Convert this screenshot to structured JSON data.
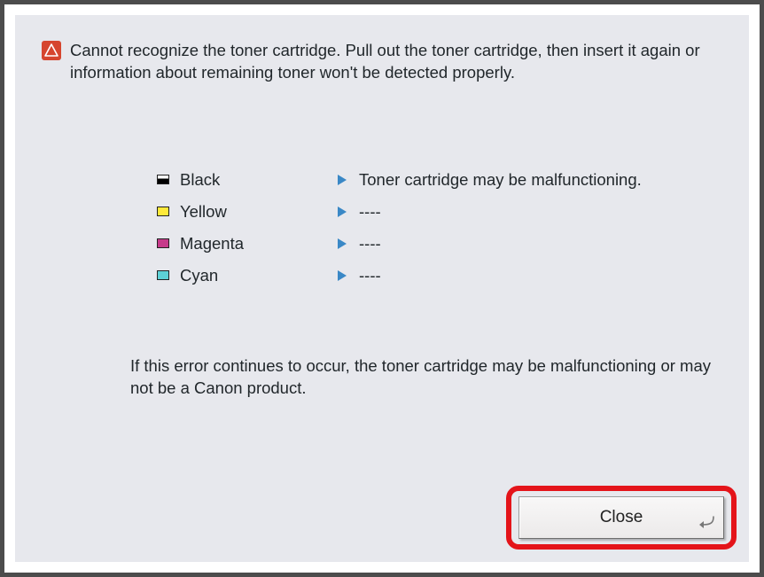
{
  "header": {
    "message": "Cannot recognize the toner cartridge. Pull out the toner cartridge, then insert it again or information about remaining toner won't be detected properly."
  },
  "toners": [
    {
      "name": "Black",
      "swatch": "swatch-black",
      "status": "Toner cartridge may be malfunctioning."
    },
    {
      "name": "Yellow",
      "swatch": "swatch-yellow",
      "status": "----"
    },
    {
      "name": "Magenta",
      "swatch": "swatch-magenta",
      "status": "----"
    },
    {
      "name": "Cyan",
      "swatch": "swatch-cyan",
      "status": "----"
    }
  ],
  "footer": {
    "message": "If this error continues to occur, the toner cartridge may be malfunctioning or may not be a Canon product."
  },
  "buttons": {
    "close": "Close"
  }
}
